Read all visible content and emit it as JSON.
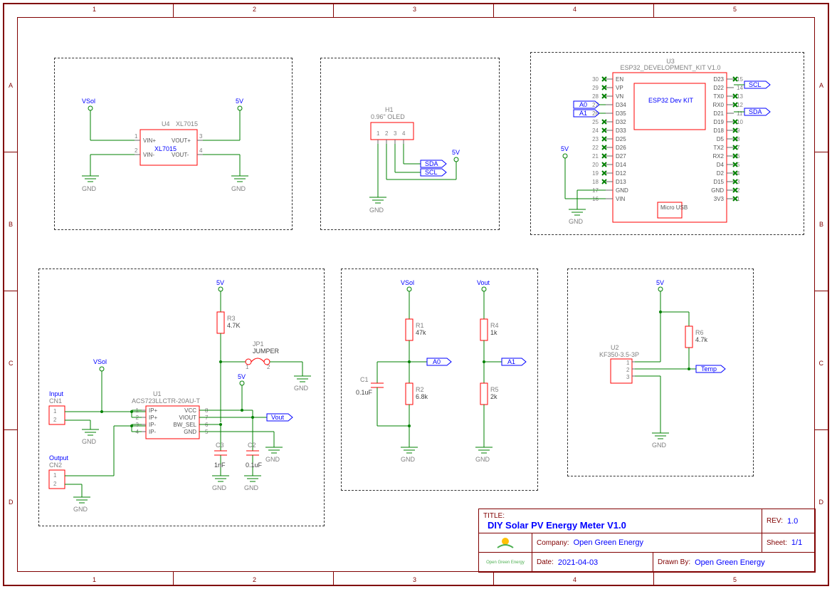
{
  "titleblock": {
    "title_label": "TITLE:",
    "title": "DIY Solar PV Energy Meter V1.0",
    "rev_label": "REV:",
    "rev": "1.0",
    "company_label": "Company:",
    "company": "Open Green Energy",
    "sheet_label": "Sheet:",
    "sheet": "1/1",
    "date_label": "Date:",
    "date": "2021-04-03",
    "drawnby_label": "Drawn By:",
    "drawnby": "Open Green Energy",
    "logo_caption": "Open Green Energy"
  },
  "ruler_nums": [
    "1",
    "2",
    "3",
    "4",
    "5"
  ],
  "ruler_lets": [
    "A",
    "B",
    "C",
    "D"
  ],
  "block1": {
    "net_vsol": "VSol",
    "net_5v": "5V",
    "gnd": "GND",
    "u4_ref": "U4",
    "u4_val": "XL7015",
    "u4_center": "XL7015",
    "pins": {
      "1": "VIN+",
      "2": "VIN-",
      "3": "VOUT+",
      "4": "VOUT-"
    }
  },
  "block2": {
    "h1_ref": "H1",
    "h1_val": "0.96\" OLED",
    "pins": [
      "1",
      "2",
      "3",
      "4"
    ],
    "net_sda": "SDA",
    "net_scl": "SCL",
    "net_5v": "5V",
    "gnd": "GND"
  },
  "block3": {
    "u3_ref": "U3",
    "u3_val": "ESP32_DEVELOPMENT_KIT V1.0",
    "center": "ESP32 Dev KIT",
    "usb": "Micro USB",
    "net_scl": "SCL",
    "net_sda": "SDA",
    "net_a0": "A0",
    "net_a1": "A1",
    "net_5v": "5V",
    "gnd": "GND",
    "left_pins": [
      {
        "n": "30",
        "name": "EN"
      },
      {
        "n": "29",
        "name": "VP"
      },
      {
        "n": "28",
        "name": "VN"
      },
      {
        "n": "27",
        "name": "D34"
      },
      {
        "n": "26",
        "name": "D35"
      },
      {
        "n": "25",
        "name": "D32"
      },
      {
        "n": "24",
        "name": "D33"
      },
      {
        "n": "23",
        "name": "D25"
      },
      {
        "n": "22",
        "name": "D26"
      },
      {
        "n": "21",
        "name": "D27"
      },
      {
        "n": "20",
        "name": "D14"
      },
      {
        "n": "19",
        "name": "D12"
      },
      {
        "n": "18",
        "name": "D13"
      },
      {
        "n": "17",
        "name": "GND"
      },
      {
        "n": "16",
        "name": "VIN"
      }
    ],
    "right_pins": [
      {
        "n": "15",
        "name": "D23"
      },
      {
        "n": "14",
        "name": "D22"
      },
      {
        "n": "13",
        "name": "TX0"
      },
      {
        "n": "12",
        "name": "RX0"
      },
      {
        "n": "11",
        "name": "D21"
      },
      {
        "n": "10",
        "name": "D19"
      },
      {
        "n": "9",
        "name": "D18"
      },
      {
        "n": "8",
        "name": "D5"
      },
      {
        "n": "7",
        "name": "TX2"
      },
      {
        "n": "6",
        "name": "RX2"
      },
      {
        "n": "5",
        "name": "D4"
      },
      {
        "n": "4",
        "name": "D2"
      },
      {
        "n": "3",
        "name": "D15"
      },
      {
        "n": "2",
        "name": "GND"
      },
      {
        "n": "1",
        "name": "3V3"
      }
    ]
  },
  "block4": {
    "net_vsol": "VSol",
    "net_5v": "5V",
    "net_5v2": "5V",
    "net_vout": "Vout",
    "gnd": "GND",
    "in_ref": "Input",
    "cn1_ref": "CN1",
    "cn1_pins": [
      "1",
      "2"
    ],
    "out_ref": "Output",
    "cn2_ref": "CN2",
    "cn2_pins": [
      "1",
      "2"
    ],
    "u1_ref": "U1",
    "u1_val": "ACS723LLCTR-20AU-T",
    "u1_pins_left": [
      {
        "n": "1",
        "name": "IP+"
      },
      {
        "n": "2",
        "name": "IP+"
      },
      {
        "n": "3",
        "name": "IP-"
      },
      {
        "n": "4",
        "name": "IP-"
      }
    ],
    "u1_pins_right": [
      {
        "n": "8",
        "name": "VCC"
      },
      {
        "n": "7",
        "name": "VIOUT"
      },
      {
        "n": "6",
        "name": "BW_SEL"
      },
      {
        "n": "5",
        "name": "GND"
      }
    ],
    "r3_ref": "R3",
    "r3_val": "4.7K",
    "jp1_ref": "JP1",
    "jp1_val": "JUMPER",
    "jp1_p1": "1",
    "jp1_p2": "2",
    "c3_ref": "C3",
    "c3_val": "1nF",
    "c2_ref": "C2",
    "c2_val": "0.1uF"
  },
  "block5": {
    "net_vsol": "VSol",
    "net_vout": "Vout",
    "net_a0": "A0",
    "net_a1": "A1",
    "gnd": "GND",
    "c1_ref": "C1",
    "c1_val": "0.1uF",
    "r1_ref": "R1",
    "r1_val": "47k",
    "r2_ref": "R2",
    "r2_val": "6.8k",
    "r4_ref": "R4",
    "r4_val": "1k",
    "r5_ref": "R5",
    "r5_val": "2k"
  },
  "block6": {
    "net_5v": "5V",
    "net_temp": "Temp",
    "gnd": "GND",
    "u2_ref": "U2",
    "u2_val": "KF350-3.5-3P",
    "u2_pins": [
      "1",
      "2",
      "3"
    ],
    "r6_ref": "R6",
    "r6_val": "4.7k"
  }
}
